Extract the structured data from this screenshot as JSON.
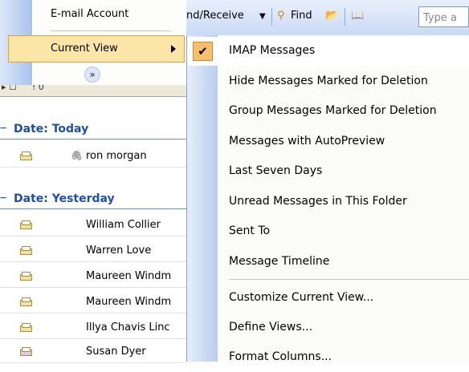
{
  "left_menu": {
    "items": [
      {
        "label": "E-mail Account",
        "mnemonic_index": 10
      },
      {
        "label": "Current View",
        "mnemonic_index": 8
      }
    ],
    "expand_icon": "double-chevron-down"
  },
  "toolbar": {
    "send_receive_label": "nd/Receive",
    "find_label": "Find",
    "search_placeholder": "Type a"
  },
  "message_list": {
    "groups": [
      {
        "label": "Date: Today",
        "toggle": "−"
      },
      {
        "label": "Date: Yesterday",
        "toggle": "−"
      }
    ],
    "today_rows": [
      {
        "sender": "ron morgan",
        "attachment": true
      }
    ],
    "yesterday_rows": [
      {
        "sender": "William Collier"
      },
      {
        "sender": "Warren Love"
      },
      {
        "sender": "Maureen Windm"
      },
      {
        "sender": "Maureen Windm"
      },
      {
        "sender": "Illya Chavis Linc"
      },
      {
        "sender": "Susan Dyer"
      }
    ]
  },
  "view_menu": {
    "checked_item": "IMAP Messages",
    "items": [
      "IMAP Messages",
      "Hide Messages Marked for Deletion",
      "Group Messages Marked for Deletion",
      "Messages with AutoPreview",
      "Last Seven Days",
      "Unread Messages in This Folder",
      "Sent To",
      "Message Timeline"
    ],
    "commands": [
      "Customize Current View...",
      "Define Views...",
      "Format Columns..."
    ]
  },
  "colors": {
    "group_header": "#1f4fa8",
    "highlight": "#fbe6a7",
    "check_bg": "#f6bf6e"
  }
}
